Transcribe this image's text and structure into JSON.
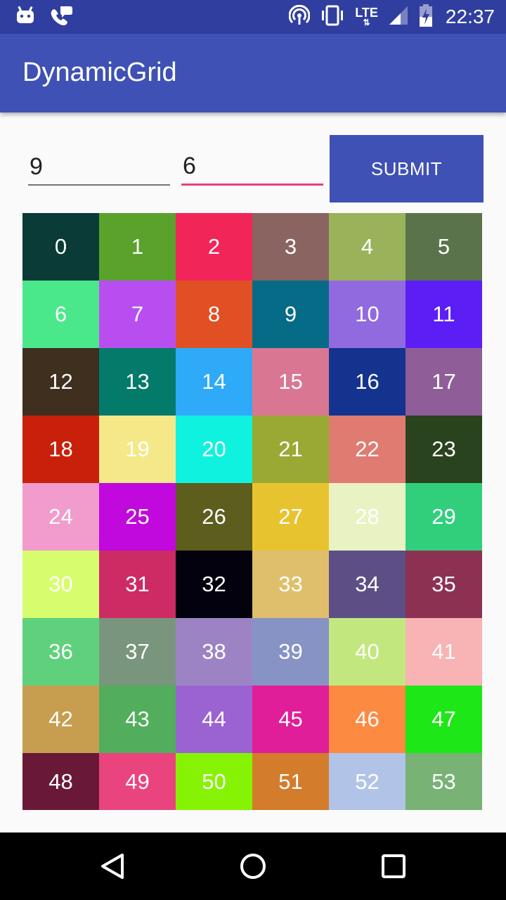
{
  "status_bar": {
    "time": "22:37",
    "network": "LTE",
    "network_arrows": "⇅",
    "icons": [
      "android-notification-icon",
      "phone-message-icon",
      "hotspot-icon",
      "vibrate-icon",
      "lte-icon",
      "signal-icon",
      "battery-charging-icon"
    ]
  },
  "app_bar": {
    "title": "DynamicGrid"
  },
  "form": {
    "rows_value": "9",
    "cols_value": "6",
    "submit_label": "SUBMIT"
  },
  "grid": {
    "rows": 9,
    "columns": 6,
    "cells": [
      {
        "label": "0",
        "color": "#0a3b36"
      },
      {
        "label": "1",
        "color": "#5aa22c"
      },
      {
        "label": "2",
        "color": "#f22558"
      },
      {
        "label": "3",
        "color": "#896461"
      },
      {
        "label": "4",
        "color": "#9ab35a"
      },
      {
        "label": "5",
        "color": "#5b734b"
      },
      {
        "label": "6",
        "color": "#4ae88a"
      },
      {
        "label": "7",
        "color": "#b94ef0"
      },
      {
        "label": "8",
        "color": "#e05024"
      },
      {
        "label": "9",
        "color": "#066b87"
      },
      {
        "label": "10",
        "color": "#916ae0"
      },
      {
        "label": "11",
        "color": "#5b1ff5"
      },
      {
        "label": "12",
        "color": "#3f2f1f"
      },
      {
        "label": "13",
        "color": "#047a6b"
      },
      {
        "label": "14",
        "color": "#2eaaf8"
      },
      {
        "label": "15",
        "color": "#d97793"
      },
      {
        "label": "16",
        "color": "#14338f"
      },
      {
        "label": "17",
        "color": "#8f5e98"
      },
      {
        "label": "18",
        "color": "#c9200c"
      },
      {
        "label": "19",
        "color": "#f5e889"
      },
      {
        "label": "20",
        "color": "#10f2e0"
      },
      {
        "label": "21",
        "color": "#99a934"
      },
      {
        "label": "22",
        "color": "#df7b70"
      },
      {
        "label": "23",
        "color": "#29431e"
      },
      {
        "label": "24",
        "color": "#f19ccc"
      },
      {
        "label": "25",
        "color": "#c108dd"
      },
      {
        "label": "26",
        "color": "#5d5d1d"
      },
      {
        "label": "27",
        "color": "#e8c330"
      },
      {
        "label": "28",
        "color": "#e9f2c2"
      },
      {
        "label": "29",
        "color": "#31cf7c"
      },
      {
        "label": "30",
        "color": "#d7fd6f"
      },
      {
        "label": "31",
        "color": "#cc2b63"
      },
      {
        "label": "32",
        "color": "#03010d"
      },
      {
        "label": "33",
        "color": "#dfbf6c"
      },
      {
        "label": "34",
        "color": "#5e4e86"
      },
      {
        "label": "35",
        "color": "#8d3152"
      },
      {
        "label": "36",
        "color": "#5fd17c"
      },
      {
        "label": "37",
        "color": "#7a957d"
      },
      {
        "label": "38",
        "color": "#9c84c4"
      },
      {
        "label": "39",
        "color": "#8793c5"
      },
      {
        "label": "40",
        "color": "#c2e77f"
      },
      {
        "label": "41",
        "color": "#f8b3b4"
      },
      {
        "label": "42",
        "color": "#c79d4f"
      },
      {
        "label": "43",
        "color": "#52ad5c"
      },
      {
        "label": "44",
        "color": "#9b62d2"
      },
      {
        "label": "45",
        "color": "#e01e99"
      },
      {
        "label": "46",
        "color": "#fd8a41"
      },
      {
        "label": "47",
        "color": "#1de716"
      },
      {
        "label": "48",
        "color": "#691937"
      },
      {
        "label": "49",
        "color": "#e9447e"
      },
      {
        "label": "50",
        "color": "#86f305"
      },
      {
        "label": "51",
        "color": "#d37c2c"
      },
      {
        "label": "52",
        "color": "#b2c3e8"
      },
      {
        "label": "53",
        "color": "#78b274"
      }
    ]
  },
  "nav_bar": {
    "buttons": [
      "back-icon",
      "home-icon",
      "recents-icon"
    ]
  },
  "colors": {
    "status_bar": "#303f9f",
    "app_bar": "#3f51b5",
    "accent": "#e9417b",
    "button": "#3f51b5",
    "background": "#fafafa"
  }
}
